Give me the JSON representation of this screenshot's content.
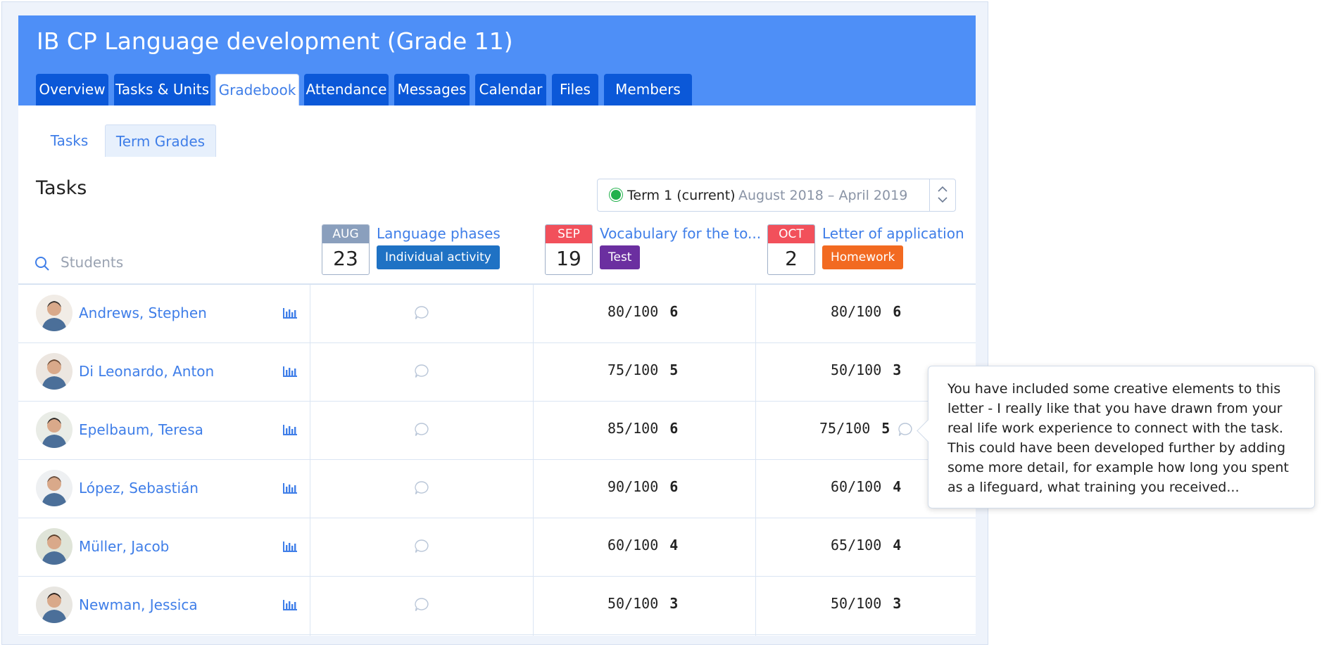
{
  "course": {
    "title": "IB CP Language development (Grade 11)"
  },
  "tabs": [
    {
      "label": "Overview"
    },
    {
      "label": "Tasks & Units"
    },
    {
      "label": "Gradebook"
    },
    {
      "label": "Attendance"
    },
    {
      "label": "Messages"
    },
    {
      "label": "Calendar"
    },
    {
      "label": "Files"
    },
    {
      "label": "Members"
    }
  ],
  "subtabs": [
    {
      "label": "Tasks"
    },
    {
      "label": "Term Grades"
    }
  ],
  "section": {
    "title": "Tasks"
  },
  "term": {
    "name": "Term 1 (current)",
    "range": "August 2018 – April 2019"
  },
  "search": {
    "placeholder": "Students"
  },
  "tasks": [
    {
      "month": "AUG",
      "day": "23",
      "title": "Language phases",
      "type": "Individual activity",
      "month_color": "#8a9fbd",
      "type_color": "#1f72c4"
    },
    {
      "month": "SEP",
      "day": "19",
      "title": "Vocabulary for the to...",
      "type": "Test",
      "month_color": "#f2505b",
      "type_color": "#6b2fa0"
    },
    {
      "month": "OCT",
      "day": "2",
      "title": "Letter of application",
      "type": "Homework",
      "month_color": "#f2505b",
      "type_color": "#f26a21"
    }
  ],
  "students": [
    {
      "name": "Andrews, Stephen",
      "task2_score": "80/100",
      "task2_grade": "6",
      "task3_score": "80/100",
      "task3_grade": "6"
    },
    {
      "name": "Di Leonardo, Anton",
      "task2_score": "75/100",
      "task2_grade": "5",
      "task3_score": "50/100",
      "task3_grade": "3"
    },
    {
      "name": "Epelbaum, Teresa",
      "task2_score": "85/100",
      "task2_grade": "6",
      "task3_score": "75/100",
      "task3_grade": "5"
    },
    {
      "name": "López, Sebastián",
      "task2_score": "90/100",
      "task2_grade": "6",
      "task3_score": "60/100",
      "task3_grade": "4"
    },
    {
      "name": "Müller, Jacob",
      "task2_score": "60/100",
      "task2_grade": "4",
      "task3_score": "65/100",
      "task3_grade": "4"
    },
    {
      "name": "Newman, Jessica",
      "task2_score": "50/100",
      "task2_grade": "3",
      "task3_score": "50/100",
      "task3_grade": "3"
    }
  ],
  "comment_tooltip": {
    "text": "You have included some creative elements to this letter - I really like that you have drawn from your real life work experience to connect with the task. This could have been developed further by adding some more detail, for example how long you spent as a lifeguard, what training you received..."
  },
  "colors": {
    "header": "#4e8ff7",
    "tab": "#0b58d8",
    "link": "#3f7ee8",
    "term_dot": "#22b14c"
  }
}
